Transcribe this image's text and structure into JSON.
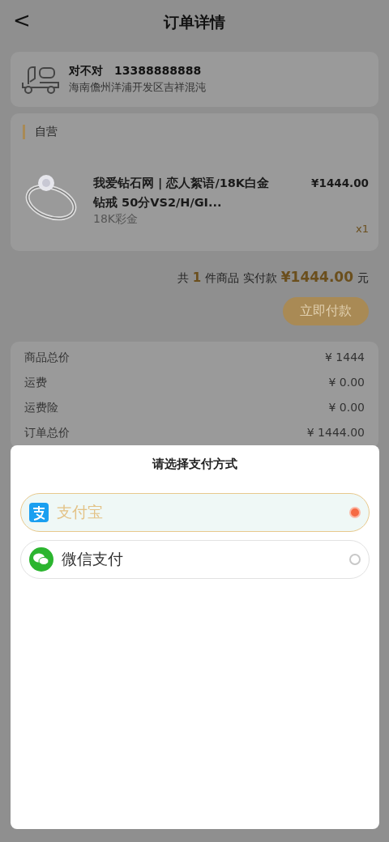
{
  "header": {
    "back": "<",
    "title": "订单详情"
  },
  "address": {
    "name": "对不对",
    "phone": "13388888888",
    "detail": "海南儋州洋浦开发区吉祥混沌"
  },
  "shop": {
    "name": "自营",
    "items": [
      {
        "kind": "picture",
        "title": "我爱钻石网 | 恋人絮语/18K白金钻戒 50分VS2/H/GI...",
        "spec": "18K彩金",
        "price": "¥1444.00",
        "qty": "x1"
      }
    ]
  },
  "summary": {
    "prefix": "共",
    "count": "1",
    "middle": "件商品 实付款",
    "total": "¥1444.00",
    "suffix": "元"
  },
  "pay_button": "立即付款",
  "costs": [
    {
      "label": "商品总价",
      "value": "¥ 1444"
    },
    {
      "label": "运费",
      "value": "¥ 0.00"
    },
    {
      "label": "运费险",
      "value": "¥ 0.00"
    },
    {
      "label": "订单总价",
      "value": "¥ 1444.00"
    }
  ],
  "sheet": {
    "title": "请选择支付方式",
    "methods": [
      {
        "kind": "alipay",
        "label": "支付宝",
        "selected": true
      },
      {
        "kind": "wechat",
        "label": "微信支付",
        "selected": false
      }
    ]
  }
}
